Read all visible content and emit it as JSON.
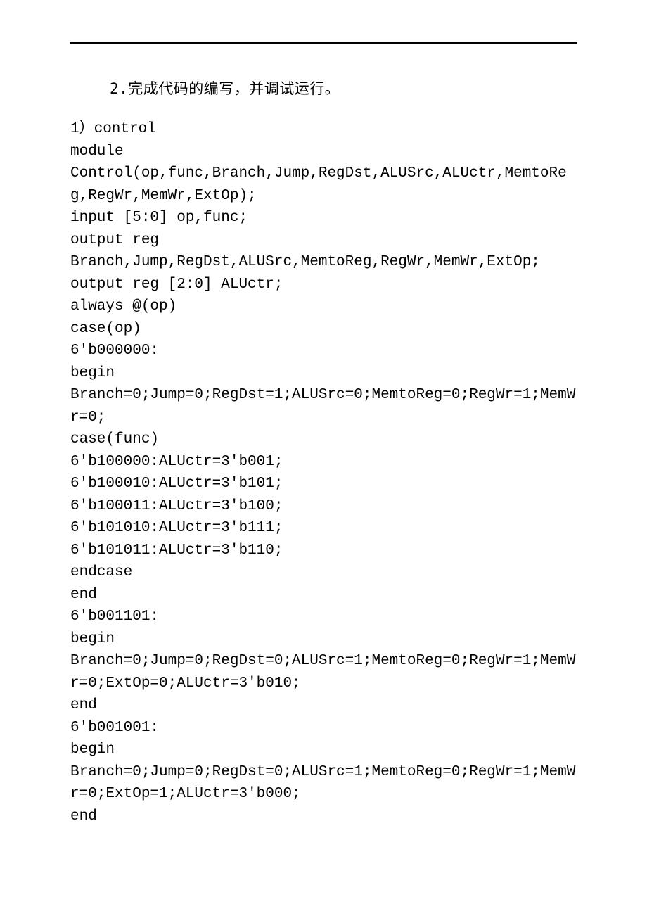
{
  "heading": "2.完成代码的编写，并调试运行。",
  "code": [
    "1）control",
    "module",
    "Control(op,func,Branch,Jump,RegDst,ALUSrc,ALUctr,MemtoReg,RegWr,MemWr,ExtOp);",
    "input [5:0] op,func;",
    "output reg",
    "Branch,Jump,RegDst,ALUSrc,MemtoReg,RegWr,MemWr,ExtOp;",
    "output reg [2:0] ALUctr;",
    "always @(op)",
    "case(op)",
    "6'b000000:",
    "begin",
    "Branch=0;Jump=0;RegDst=1;ALUSrc=0;MemtoReg=0;RegWr=1;MemWr=0;",
    "case(func)",
    "6'b100000:ALUctr=3'b001;",
    "6'b100010:ALUctr=3'b101;",
    "6'b100011:ALUctr=3'b100;",
    "6'b101010:ALUctr=3'b111;",
    "6'b101011:ALUctr=3'b110;",
    "endcase",
    "end",
    "6'b001101:",
    "begin",
    "Branch=0;Jump=0;RegDst=0;ALUSrc=1;MemtoReg=0;RegWr=1;MemWr=0;ExtOp=0;ALUctr=3'b010;",
    "end",
    "6'b001001:",
    "begin",
    "Branch=0;Jump=0;RegDst=0;ALUSrc=1;MemtoReg=0;RegWr=1;MemWr=0;ExtOp=1;ALUctr=3'b000;",
    "end"
  ]
}
